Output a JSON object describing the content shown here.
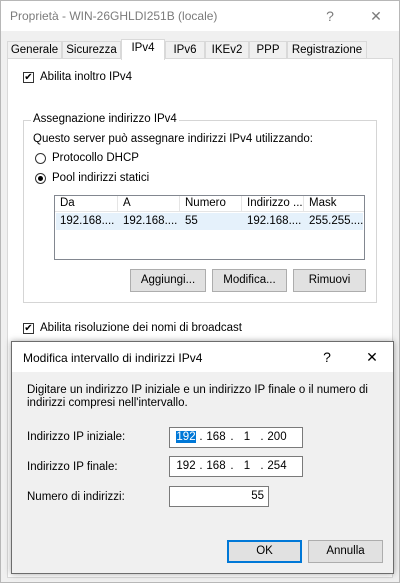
{
  "main_window": {
    "title": "Proprietà - WIN-26GHLDI251B (locale)",
    "help": "?",
    "close": "✕"
  },
  "tabs": [
    {
      "label": "Generale"
    },
    {
      "label": "Sicurezza"
    },
    {
      "label": "IPv4",
      "active": true
    },
    {
      "label": "IPv6"
    },
    {
      "label": "IKEv2"
    },
    {
      "label": "PPP"
    },
    {
      "label": "Registrazione"
    }
  ],
  "ipv4": {
    "enable_forwarding_label": "Abilita inoltro IPv4",
    "enable_forwarding_checked": true,
    "group_title": "Assegnazione indirizzo IPv4",
    "group_desc": "Questo server può assegnare indirizzi IPv4 utilizzando:",
    "dhcp_label": "Protocollo DHCP",
    "static_pool_label": "Pool indirizzi statici",
    "selected": "static",
    "columns": [
      "Da",
      "A",
      "Numero",
      "Indirizzo ...",
      "Mask"
    ],
    "rows": [
      [
        "192.168....",
        "192.168....",
        "55",
        "192.168....",
        "255.255...."
      ]
    ],
    "add_button": "Aggiungi...",
    "edit_button": "Modifica...",
    "remove_button": "Rimuovi",
    "broadcast_label": "Abilita risoluzione dei nomi di broadcast",
    "broadcast_checked": true
  },
  "dialog": {
    "title": "Modifica intervallo di indirizzi IPv4",
    "help": "?",
    "close": "✕",
    "description": "Digitare un indirizzo IP iniziale e un indirizzo IP finale o il numero di indirizzi compresi nell'intervallo.",
    "start_label": "Indirizzo IP iniziale:",
    "start_octets": [
      "192",
      "168",
      "1",
      "200"
    ],
    "end_label": "Indirizzo IP finale:",
    "end_octets": [
      "192",
      "168",
      "1",
      "254"
    ],
    "count_label": "Numero di indirizzi:",
    "count_value": "55",
    "ok_button": "OK",
    "cancel_button": "Annulla"
  }
}
